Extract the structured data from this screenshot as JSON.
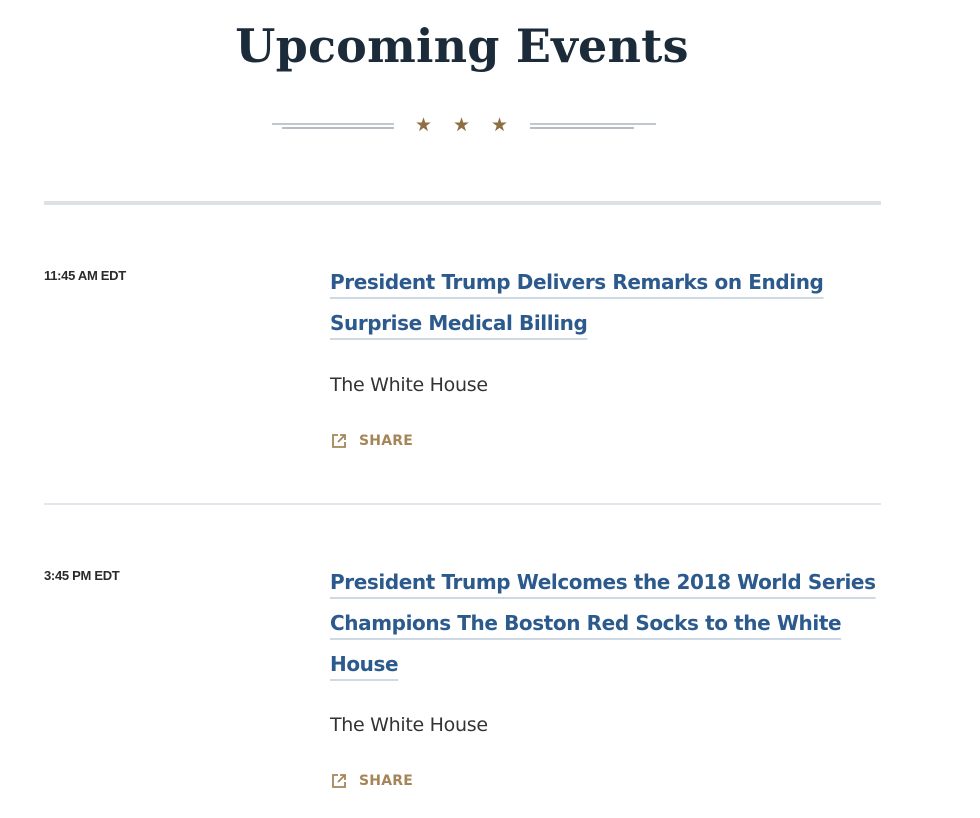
{
  "page": {
    "title": "Upcoming Events"
  },
  "ornament": {
    "star_glyph": "★",
    "color": "#8f6e43"
  },
  "colors": {
    "title": "#1c2b3a",
    "link": "#2c5a8d",
    "share": "#a58558"
  },
  "events": [
    {
      "time": "11:45 AM EDT",
      "title": "President Trump Delivers Remarks on Ending Surprise Medical Billing",
      "location": "The White House",
      "share_label": "SHARE",
      "share_icon": "external-share-icon"
    },
    {
      "time": "3:45 PM EDT",
      "title": "President Trump Welcomes the 2018 World Series Champions The Boston Red Socks to the White House",
      "location": "The White House",
      "share_label": "SHARE",
      "share_icon": "external-share-icon"
    }
  ]
}
